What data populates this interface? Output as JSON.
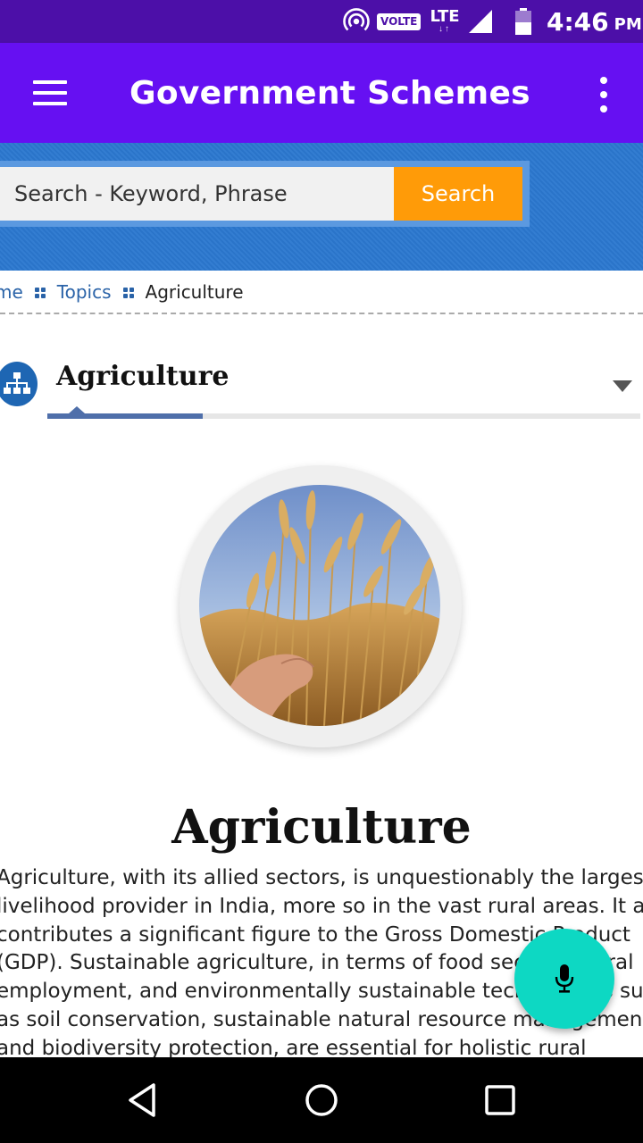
{
  "status_bar": {
    "volte": "VOLTE",
    "network": "LTE",
    "network_arrows": "↓↑",
    "time": "4:46",
    "ampm": "PM",
    "icons": [
      "hotspot-icon",
      "signal-icon",
      "battery-icon"
    ]
  },
  "app_bar": {
    "title": "Government Schemes",
    "menu_icon": "hamburger-menu-icon",
    "overflow_icon": "more-vertical-icon",
    "color": "#6610f2"
  },
  "search": {
    "placeholder": "Search - Keyword, Phrase",
    "button_label": "Search",
    "button_color": "#ff9b08"
  },
  "breadcrumb": {
    "items": [
      "me",
      "Topics",
      "Agriculture"
    ]
  },
  "topic_selector": {
    "selected": "Agriculture",
    "icon": "sitemap-icon"
  },
  "content": {
    "title": "Agriculture",
    "lines": [
      "Agriculture, with its allied sectors, is unquestionably the largest",
      "livelihood provider in India, more so in the vast rural areas. It also",
      "contributes a significant figure to the Gross Domestic Product",
      "(GDP). Sustainable agriculture, in terms of food security, rural",
      "employment, and environmentally sustainable technologies such",
      "as soil conservation, sustainable natural resource management",
      "and biodiversity protection, are essential for holistic rural"
    ]
  },
  "fab": {
    "icon": "microphone-icon",
    "color": "#0dd8c3"
  },
  "nav": {
    "icons": [
      "back-icon",
      "home-icon",
      "recents-icon"
    ]
  }
}
